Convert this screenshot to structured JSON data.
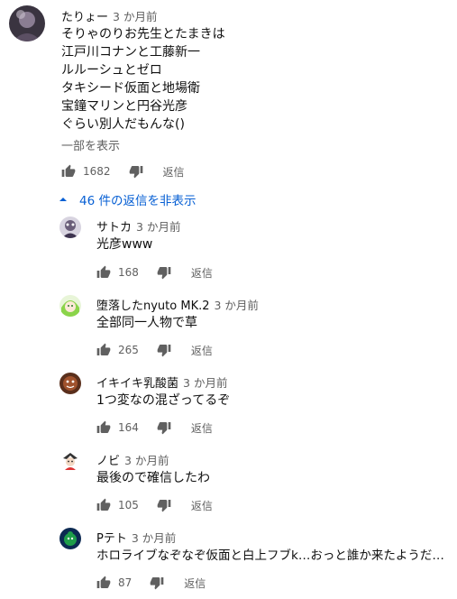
{
  "main_comment": {
    "author": "たりょー",
    "time": "3 か月前",
    "lines": [
      "そりゃのりお先生とたまきは",
      "江戸川コナンと工藤新一",
      "ルルーシュとゼロ",
      "タキシード仮面と地場衛",
      "宝鐘マリンと円谷光彦",
      "ぐらい別人だもんな()"
    ],
    "read_more": "一部を表示",
    "likes": "1682",
    "reply_label": "返信"
  },
  "replies_toggle": {
    "label": "46 件の返信を非表示",
    "color": "#065fd4"
  },
  "replies": [
    {
      "author": "サトカ",
      "time": "3 か月前",
      "text": "光彦www",
      "likes": "168",
      "reply_label": "返信"
    },
    {
      "author": "堕落したnyuto MK.2",
      "time": "3 か月前",
      "text": "全部同一人物で草",
      "likes": "265",
      "reply_label": "返信"
    },
    {
      "author": "イキイキ乳酸菌",
      "time": "3 か月前",
      "text": "1つ変なの混ざってるぞ",
      "likes": "164",
      "reply_label": "返信"
    },
    {
      "author": "ノビ",
      "time": "3 か月前",
      "text": "最後ので確信したわ",
      "likes": "105",
      "reply_label": "返信"
    },
    {
      "author": "Pテト",
      "time": "3 か月前",
      "text": "ホロライブなぞなぞ仮面と白上フブk…おっと誰か来たようだ…",
      "likes": "87",
      "reply_label": "返信"
    }
  ],
  "icons": {
    "like": "thumbs-up-icon",
    "dislike": "thumbs-down-icon",
    "collapse": "caret-up-icon"
  }
}
